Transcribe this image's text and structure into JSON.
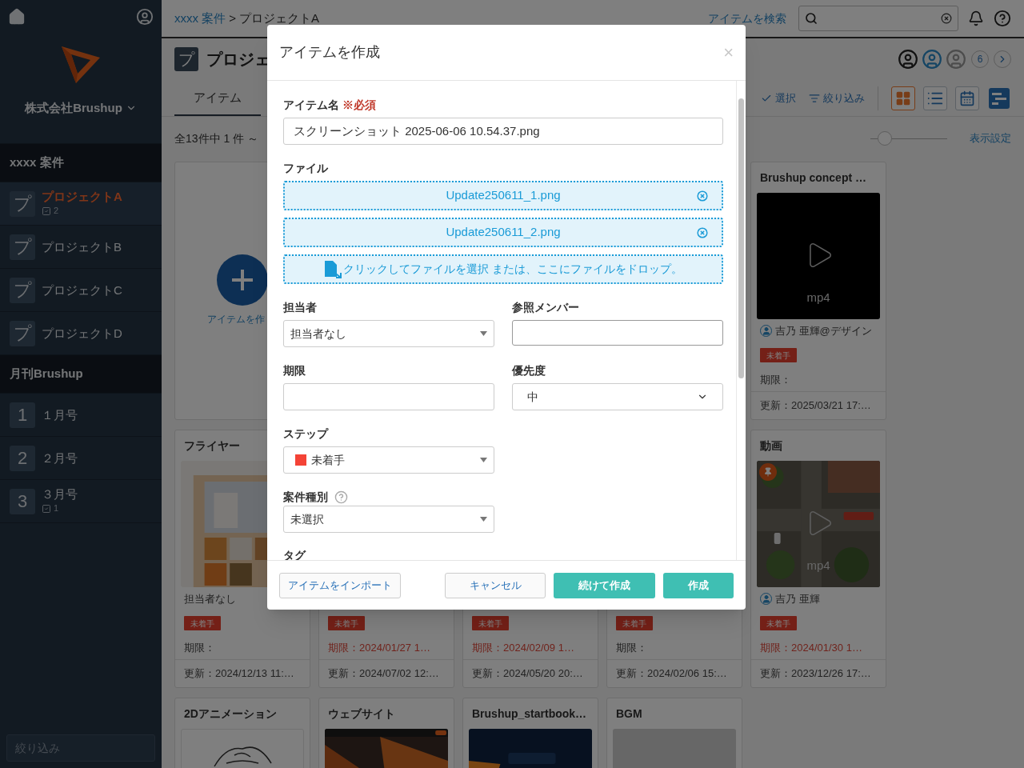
{
  "sidebar": {
    "company": "株式会社Brushup",
    "groups": [
      {
        "title": "xxxx 案件",
        "items": [
          {
            "icon": "プ",
            "label": "プロジェクトA",
            "selected": true,
            "count": "2"
          },
          {
            "icon": "プ",
            "label": "プロジェクトB",
            "selected": false
          },
          {
            "icon": "プ",
            "label": "プロジェクトC",
            "selected": false
          },
          {
            "icon": "プ",
            "label": "プロジェクトD",
            "selected": false
          }
        ]
      },
      {
        "title": "月刊Brushup",
        "items": [
          {
            "icon": "1",
            "label": "１月号",
            "selected": false
          },
          {
            "icon": "2",
            "label": "２月号",
            "selected": false
          },
          {
            "icon": "3",
            "label": "３月号",
            "selected": false,
            "count": "1"
          }
        ]
      }
    ],
    "filter": {
      "placeholder": "絞り込み"
    }
  },
  "topbar": {
    "breadcrumb": [
      "xxxx 案件",
      "プロジェクトA"
    ],
    "breadcrumb_separator": ">",
    "search_link": "アイテムを検索"
  },
  "header": {
    "icon": "プ",
    "title": "プロジェ",
    "member_count": "6"
  },
  "tabs": [
    {
      "label": "アイテム",
      "selected": true
    }
  ],
  "toolbar": {
    "actions": [
      {
        "kind": "select",
        "label": "選択"
      },
      {
        "kind": "filter",
        "label": "絞り込み"
      }
    ],
    "views": [
      {
        "kind": "tiles",
        "selected": true
      },
      {
        "kind": "list",
        "selected": false
      },
      {
        "kind": "calendar",
        "selected": false
      },
      {
        "kind": "gantt",
        "selected": false
      }
    ]
  },
  "count_text": "全13件中 1 件 ～",
  "size_slider": {
    "level": 0.12
  },
  "display_settings": "表示設定",
  "card_rows": [
    {
      "cards": [
        {
          "kind": "create",
          "label": "アイテムを作"
        },
        {
          "kind": "item",
          "title": "Brushup concept …",
          "thumbnail": {
            "kind": "video",
            "photo": false,
            "label": "mp4",
            "pinned": false
          },
          "assignee": {
            "kind": "user",
            "name": "吉乃 亜輝@デザイン"
          },
          "status": "未着手",
          "due": "期限：",
          "overdue": false,
          "updated": "更新：2025/03/21 17:…"
        }
      ]
    },
    {
      "cards": [
        {
          "kind": "item",
          "title": "フライヤー",
          "assignee": {
            "kind": "none",
            "name": "担当者なし"
          },
          "status": "未着手",
          "due": "期限：",
          "overdue": false,
          "updated": "更新：2024/12/13 11:…"
        },
        {
          "kind": "item",
          "status": "未着手",
          "due": "期限：2024/01/27 1…",
          "overdue": true,
          "updated": "更新：2024/07/02 12:…"
        },
        {
          "kind": "item",
          "status": "未着手",
          "due": "期限：2024/02/09 1…",
          "overdue": true,
          "updated": "更新：2024/05/20 20:…"
        },
        {
          "kind": "item",
          "status": "未着手",
          "due": "期限：",
          "overdue": false,
          "updated": "更新：2024/02/06 15:…"
        },
        {
          "kind": "item",
          "title": "動画",
          "thumbnail": {
            "kind": "video",
            "photo": true,
            "label": "mp4",
            "pinned": true
          },
          "assignee": {
            "kind": "user",
            "name": "吉乃 亜輝"
          },
          "status": "未着手",
          "due": "期限：2024/01/30 1…",
          "overdue": true,
          "updated": "更新：2023/12/26 17:…"
        }
      ]
    },
    {
      "cards": [
        {
          "kind": "item",
          "title": "2Dアニメーション",
          "thumbnail": {
            "kind": "sketch"
          }
        },
        {
          "kind": "item",
          "title": "ウェブサイト"
        },
        {
          "kind": "item",
          "title": "Brushup_startbook…"
        },
        {
          "kind": "item",
          "title": "BGM",
          "thumbnail": {
            "kind": "blank"
          }
        }
      ]
    }
  ],
  "modal": {
    "title": "アイテムを作成",
    "close": "×",
    "name_field": {
      "label": "アイテム名",
      "required": "※必須",
      "value": "スクリーンショット 2025-06-06 10.54.37.png"
    },
    "file_field": {
      "label": "ファイル",
      "files": [
        "Update250611_1.png",
        "Update250611_2.png"
      ],
      "dropzone": "クリックしてファイルを選択 または、ここにファイルをドロップ。"
    },
    "assignee_field": {
      "label": "担当者",
      "value": "担当者なし"
    },
    "members_field": {
      "label": "参照メンバー"
    },
    "due_field": {
      "label": "期限"
    },
    "priority_field": {
      "label": "優先度",
      "value": "中"
    },
    "step_field": {
      "label": "ステップ",
      "value": "未着手",
      "color": "#f44336"
    },
    "type_field": {
      "label": "案件種別",
      "value": "未選択"
    },
    "tag_field": {
      "label": "タグ"
    },
    "footer": {
      "import": "アイテムをインポート",
      "cancel": "キャンセル",
      "continue": "続けて作成",
      "create": "作成"
    }
  }
}
